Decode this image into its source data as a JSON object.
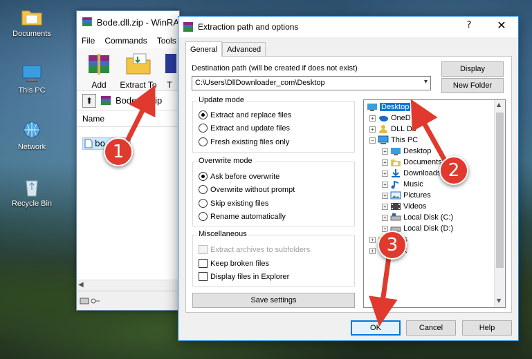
{
  "desktop": {
    "icons": [
      {
        "label": "Documents",
        "icon": "folder-icon"
      },
      {
        "label": "This PC",
        "icon": "computer-icon"
      },
      {
        "label": "Network",
        "icon": "network-icon"
      },
      {
        "label": "Recycle Bin",
        "icon": "recycle-bin-icon"
      }
    ]
  },
  "winrar": {
    "title": "Bode.dll.zip - WinRA",
    "menu": [
      "File",
      "Commands",
      "Tools"
    ],
    "toolbar": {
      "add": "Add",
      "extract": "Extract To",
      "third": "T"
    },
    "address": "Bode.dll.zip",
    "column_name": "Name",
    "file": "bo"
  },
  "dialog": {
    "title": "Extraction path and options",
    "help": "?",
    "close": "✕",
    "tabs": [
      "General",
      "Advanced"
    ],
    "destination_label": "Destination path (will be created if does not exist)",
    "destination_value": "C:\\Users\\DllDownloader_com\\Desktop",
    "display_button": "Display",
    "new_folder_button": "New Folder",
    "update_mode": {
      "title": "Update mode",
      "options": [
        "Extract and replace files",
        "Extract and update files",
        "Fresh existing files only"
      ],
      "selected": 0
    },
    "overwrite_mode": {
      "title": "Overwrite mode",
      "options": [
        "Ask before overwrite",
        "Overwrite without prompt",
        "Skip existing files",
        "Rename automatically"
      ],
      "selected": 0
    },
    "miscellaneous": {
      "title": "Miscellaneous",
      "options": [
        {
          "label": "Extract archives to subfolders",
          "disabled": true,
          "checked": false
        },
        {
          "label": "Keep broken files",
          "disabled": false,
          "checked": false
        },
        {
          "label": "Display files in Explorer",
          "disabled": false,
          "checked": false
        }
      ]
    },
    "save_settings": "Save settings",
    "tree": [
      {
        "label": "Desktop",
        "icon": "desktop-icon",
        "selected": true,
        "expander": ""
      },
      {
        "label": "OneD",
        "icon": "onedrive-icon",
        "expander": "+"
      },
      {
        "label": "DLL Do",
        "icon": "user-folder-icon",
        "expander": "+"
      },
      {
        "label": "This PC",
        "icon": "computer-icon",
        "expander": "−"
      },
      {
        "label": "Desktop",
        "icon": "desktop-icon",
        "expander": "+"
      },
      {
        "label": "Documents",
        "icon": "documents-icon",
        "expander": "+"
      },
      {
        "label": "Downloads",
        "icon": "downloads-icon",
        "expander": "+"
      },
      {
        "label": "Music",
        "icon": "music-icon",
        "expander": "+"
      },
      {
        "label": "Pictures",
        "icon": "pictures-icon",
        "expander": "+"
      },
      {
        "label": "Videos",
        "icon": "videos-icon",
        "expander": "+"
      },
      {
        "label": "Local Disk (C:)",
        "icon": "disk-icon",
        "expander": "+"
      },
      {
        "label": "Local Disk (D:)",
        "icon": "disk-icon",
        "expander": "+"
      },
      {
        "label": "aries",
        "icon": "library-icon",
        "expander": "+"
      },
      {
        "label": "work",
        "icon": "network-icon",
        "expander": "+"
      }
    ],
    "ok": "OK",
    "cancel": "Cancel",
    "help_button": "Help"
  },
  "annotations": [
    "1",
    "2",
    "3"
  ],
  "colors": {
    "accent": "#0078d7",
    "badge": "#e03a2e"
  }
}
